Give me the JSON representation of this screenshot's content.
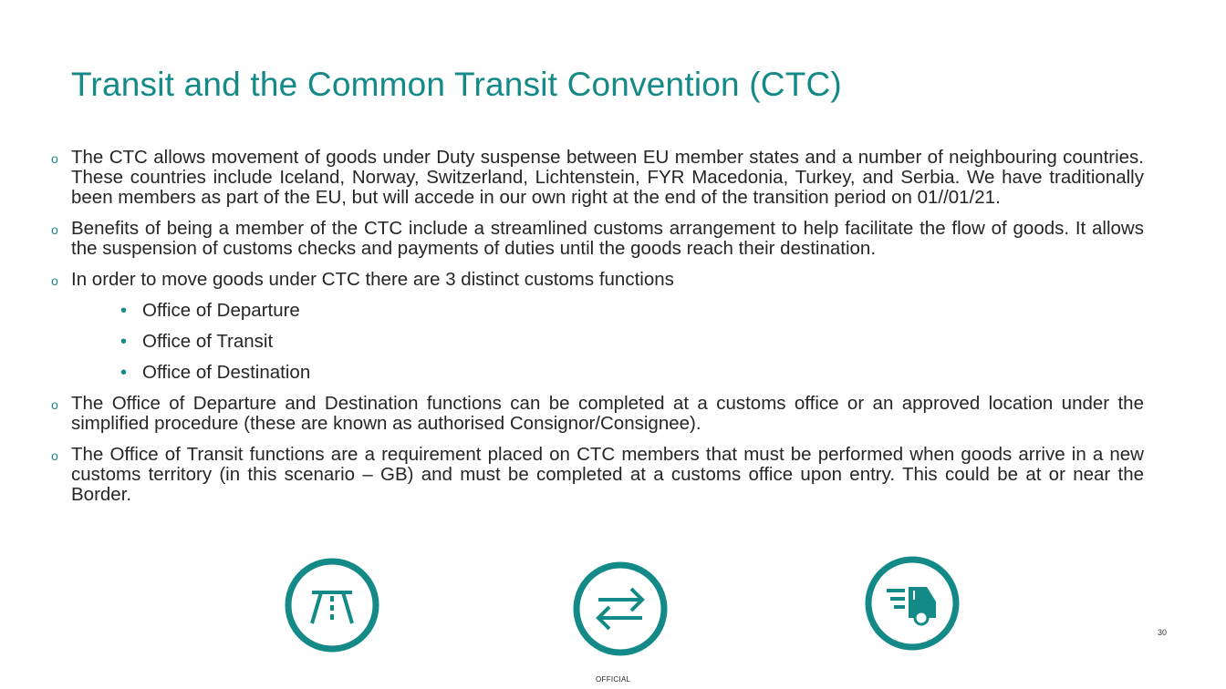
{
  "slide": {
    "title": "Transit and the Common Transit Convention (CTC)",
    "accent_color": "#138a88",
    "bullets": [
      {
        "marker": "o",
        "text": "The CTC allows movement of goods under Duty suspense between EU member states and a number of neighbouring countries.  These countries include Iceland, Norway, Switzerland, Lichtenstein, FYR Macedonia, Turkey, and Serbia. We have traditionally been members as part of the EU, but will accede in our own right at the end of the transition period on 01//01/21."
      },
      {
        "marker": "o",
        "text": "Benefits of being a member of the CTC include a streamlined customs arrangement to help facilitate the flow of goods. It allows the suspension of customs checks and payments of duties until the goods reach their destination."
      },
      {
        "marker": "o",
        "text": "In order to move goods under CTC there are 3 distinct customs functions"
      }
    ],
    "sub_bullets": [
      {
        "marker": "•",
        "text": "Office of Departure"
      },
      {
        "marker": "•",
        "text": "Office of Transit"
      },
      {
        "marker": "•",
        "text": "Office of Destination"
      }
    ],
    "bullets_after": [
      {
        "marker": "o",
        "text": "The Office of Departure and Destination functions can be completed at a customs office or an approved location under the simplified procedure (these are known as authorised Consignor/Consignee)."
      },
      {
        "marker": "o",
        "text": "The Office of Transit functions are a requirement placed on CTC members that must be performed when goods arrive in a new customs territory (in this scenario – GB) and must be completed at a customs office upon entry. This could be at or near the Border."
      }
    ],
    "icons": [
      "road-icon",
      "exchange-arrows-icon",
      "delivery-truck-icon"
    ],
    "page_number": "30",
    "classification": "OFFICIAL"
  }
}
